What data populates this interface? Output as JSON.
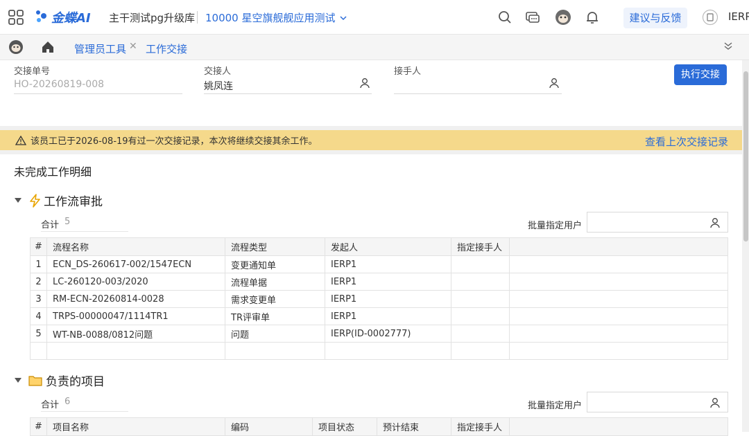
{
  "header": {
    "logo_text": "金蝶AI",
    "org": "主干测试pg升级库",
    "database": "10000 星空旗舰舰应用测试",
    "feedback": "建议与反馈",
    "user": "IERP"
  },
  "tabs": [
    {
      "label": "管理员工具"
    },
    {
      "label": "工作交接"
    }
  ],
  "form": {
    "doc_no_label": "交接单号",
    "doc_no_value": "HO-20260819-008",
    "handover_label": "交接人",
    "handover_value": "姚凤连",
    "receiver_label": "接手人",
    "receiver_value": "",
    "execute_label": "执行交接"
  },
  "warning": {
    "text": "该员工已于2026-08-19有过一次交接记录，本次将继续交接其余工作。",
    "link": "查看上次交接记录"
  },
  "detail_title": "未完成工作明细",
  "workflow": {
    "title": "工作流审批",
    "total_label": "合计",
    "total": "5",
    "batch_label": "批量指定用户",
    "columns": [
      "#",
      "流程名称",
      "流程类型",
      "发起人",
      "指定接手人",
      ""
    ],
    "rows": [
      [
        "1",
        "ECN_DS-260617-002/1547ECN",
        "变更通知单",
        "IERP1",
        "",
        ""
      ],
      [
        "2",
        "LC-260120-003/2020",
        "流程单据",
        "IERP1",
        "",
        ""
      ],
      [
        "3",
        "RM-ECN-20260814-0028",
        "需求变更单",
        "IERP1",
        "",
        ""
      ],
      [
        "4",
        "TRPS-00000047/1114TR1",
        "TR评审单",
        "IERP1",
        "",
        ""
      ],
      [
        "5",
        "WT-NB-0088/0812问题",
        "问题",
        "IERP(ID-0002777)",
        "",
        ""
      ]
    ]
  },
  "projects": {
    "title": "负责的项目",
    "total_label": "合计",
    "total": "6",
    "batch_label": "批量指定用户",
    "columns": [
      "#",
      "项目名称",
      "编码",
      "项目状态",
      "预计结束",
      "指定接手人",
      ""
    ]
  },
  "colors": {
    "accent": "#2a6bd8",
    "warning_bg": "#f5d98b"
  }
}
